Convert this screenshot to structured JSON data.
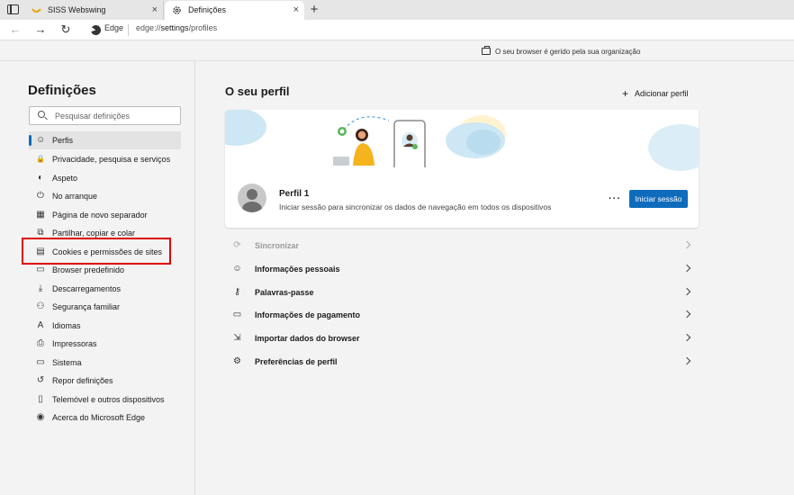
{
  "browser": {
    "tabs": [
      {
        "label": "SISS Webswing",
        "close": "×"
      },
      {
        "label": "Definições",
        "close": "×"
      }
    ],
    "new_tab": "+",
    "site_name": "Edge",
    "url_scheme": "edge://",
    "url_rest": "settings",
    "url_path": "/profiles",
    "managed_notice": "O seu browser é gerido pela sua organização"
  },
  "sidebar": {
    "title": "Definições",
    "search_placeholder": "Pesquisar definições",
    "items": [
      {
        "label": "Perfis",
        "icon": "profile-icon",
        "glyph": "☺"
      },
      {
        "label": "Privacidade, pesquisa e serviços",
        "icon": "lock-icon",
        "glyph": "🔒"
      },
      {
        "label": "Aspeto",
        "icon": "appearance-icon",
        "glyph": "◐"
      },
      {
        "label": "No arranque",
        "icon": "power-icon",
        "glyph": "⏻"
      },
      {
        "label": "Página de novo separador",
        "icon": "new-tab-page-icon",
        "glyph": "▦"
      },
      {
        "label": "Partilhar, copiar e colar",
        "icon": "share-icon",
        "glyph": "⧉"
      },
      {
        "label": "Cookies e permissões de sites",
        "icon": "cookies-icon",
        "glyph": "▤"
      },
      {
        "label": "Browser predefinido",
        "icon": "default-browser-icon",
        "glyph": "▭"
      },
      {
        "label": "Descarregamentos",
        "icon": "download-icon",
        "glyph": "⤓"
      },
      {
        "label": "Segurança familiar",
        "icon": "family-icon",
        "glyph": "⚇"
      },
      {
        "label": "Idiomas",
        "icon": "language-icon",
        "glyph": "A"
      },
      {
        "label": "Impressoras",
        "icon": "printer-icon",
        "glyph": "⎙"
      },
      {
        "label": "Sistema",
        "icon": "system-icon",
        "glyph": "▭"
      },
      {
        "label": "Repor definições",
        "icon": "reset-icon",
        "glyph": "↺"
      },
      {
        "label": "Telemóvel e outros dispositivos",
        "icon": "phone-icon",
        "glyph": "▯"
      },
      {
        "label": "Acerca do Microsoft Edge",
        "icon": "edge-icon",
        "glyph": "◉"
      }
    ]
  },
  "main": {
    "title": "O seu perfil",
    "add_profile": "Adicionar perfil",
    "profile": {
      "name": "Perfil 1",
      "description": "Iniciar sessão para sincronizar os dados de navegação em todos os dispositivos",
      "more": "···",
      "signin": "Iniciar sessão"
    },
    "rows": [
      {
        "label": "Sincronizar",
        "icon": "sync-icon",
        "glyph": "⟳",
        "disabled": true
      },
      {
        "label": "Informações pessoais",
        "icon": "personal-info-icon",
        "glyph": "☺"
      },
      {
        "label": "Palavras-passe",
        "icon": "key-icon",
        "glyph": "⚷"
      },
      {
        "label": "Informações de pagamento",
        "icon": "credit-card-icon",
        "glyph": "▭"
      },
      {
        "label": "Importar dados do browser",
        "icon": "import-icon",
        "glyph": "⇲"
      },
      {
        "label": "Preferências de perfil",
        "icon": "profile-prefs-icon",
        "glyph": "⚙"
      }
    ]
  },
  "colors": {
    "accent": "#0f6cbd",
    "highlight": "#e00000"
  }
}
